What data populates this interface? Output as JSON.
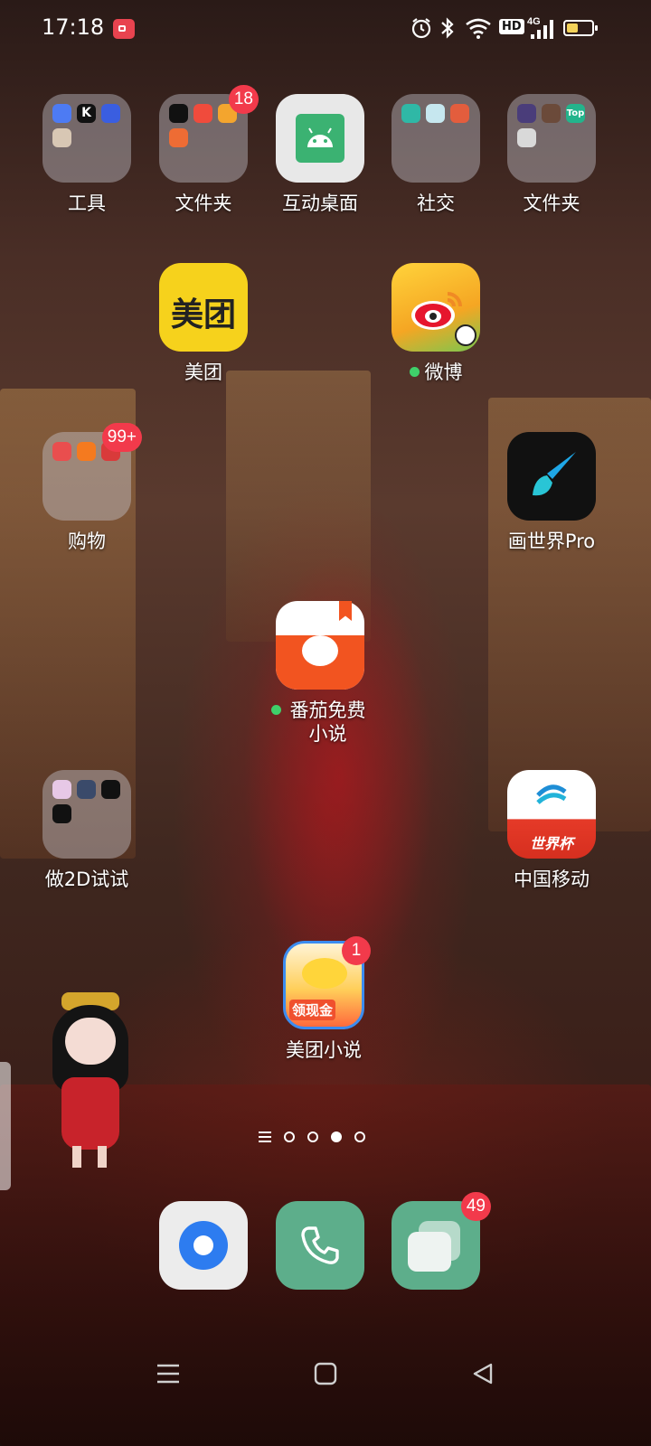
{
  "status_bar": {
    "time": "17:18",
    "hd_label": "HD",
    "network": "4G",
    "battery_level": 0.45,
    "battery_color": "#f3d25a"
  },
  "apps": {
    "row1": [
      {
        "label": "工具",
        "type": "folder"
      },
      {
        "label": "文件夹",
        "type": "folder",
        "badge": "18"
      },
      {
        "label": "互动桌面",
        "type": "app",
        "icon": "android-icon"
      },
      {
        "label": "社交",
        "type": "folder"
      },
      {
        "label": "文件夹",
        "type": "folder"
      }
    ],
    "meituan": {
      "label": "美团",
      "icon_text": "美团"
    },
    "weibo": {
      "label": "微博"
    },
    "shopping": {
      "label": "购物",
      "badge": "99+"
    },
    "huashijie": {
      "label": "画世界Pro"
    },
    "fanqie": {
      "label": "番茄免费小说"
    },
    "do2d": {
      "label": "做2D试试"
    },
    "china_mobile": {
      "label": "中国移动",
      "icon_text": "世界杯"
    },
    "meituan_novel": {
      "label": "美团小说",
      "badge": "1",
      "icon_text": "领现金"
    }
  },
  "folder_mini_labels": {
    "toolK": "K",
    "top": "Top"
  },
  "page_indicator": {
    "pages": 4,
    "active": 3
  },
  "dock": [
    {
      "name": "browser",
      "badge": ""
    },
    {
      "name": "phone",
      "badge": ""
    },
    {
      "name": "messages",
      "badge": "49"
    }
  ],
  "colors": {
    "badge": "#f23a4b",
    "meituan_yellow": "#f6d21c",
    "phone_green": "#5dae8b",
    "online_dot": "#3fd06a"
  }
}
